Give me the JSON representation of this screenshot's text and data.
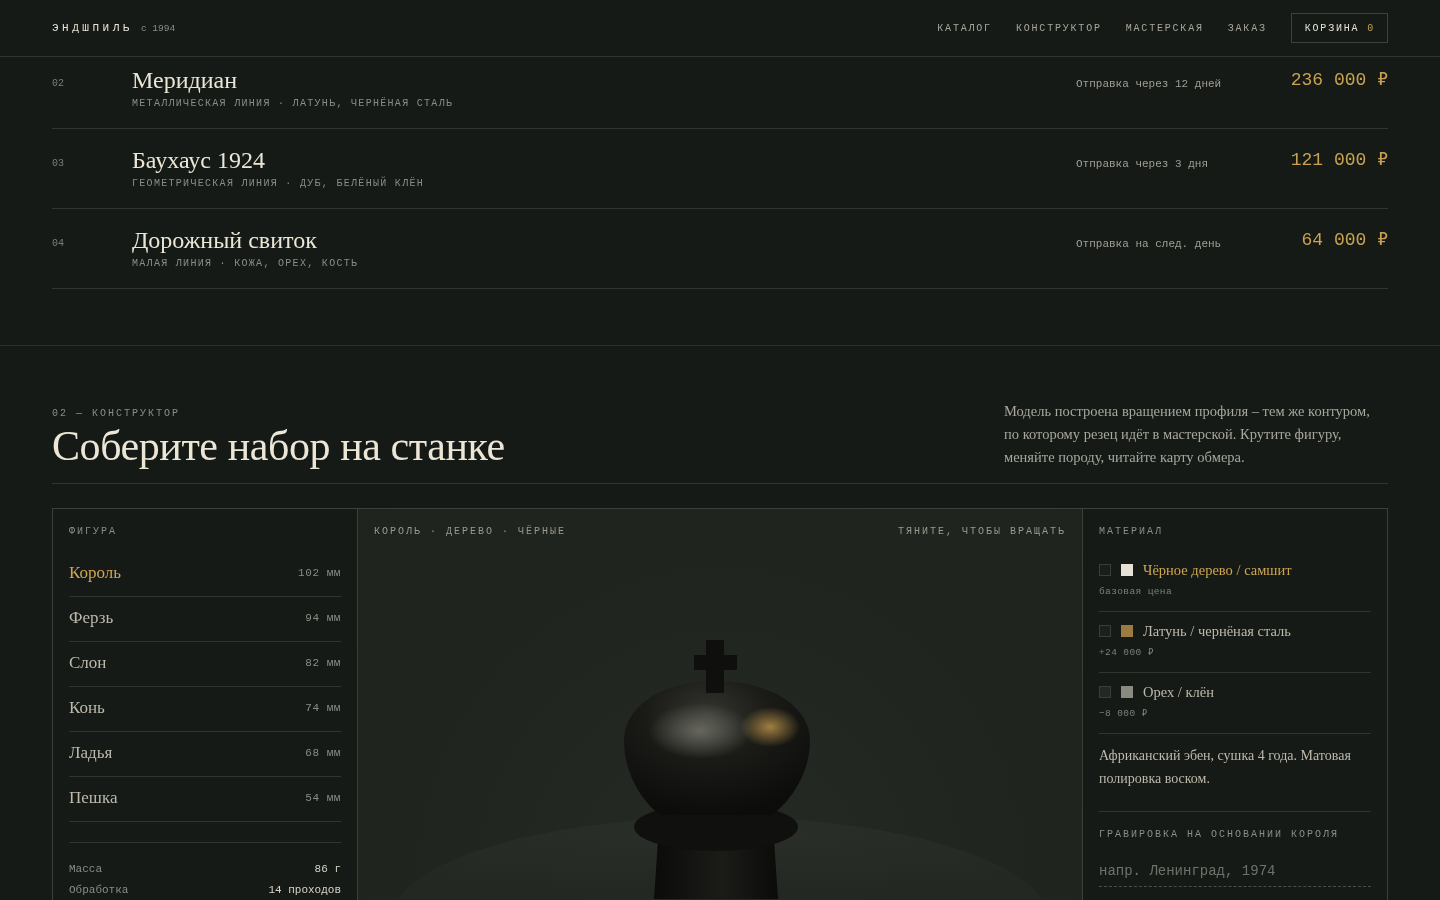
{
  "header": {
    "logo": "ЭНДШПИЛЬ",
    "since": "с 1994",
    "nav": [
      {
        "label": "КАТАЛОГ"
      },
      {
        "label": "КОНСТРУКТОР"
      },
      {
        "label": "МАСТЕРСКАЯ"
      },
      {
        "label": "ЗАКАЗ"
      }
    ],
    "cart": {
      "label": "КОРЗИНА",
      "count": "0"
    }
  },
  "catalog": {
    "rows": [
      {
        "number": "02",
        "title": "Меридиан",
        "subtitle": "МЕТАЛЛИЧЕСКАЯ ЛИНИЯ · ЛАТУНЬ, ЧЕРНЁНАЯ СТАЛЬ",
        "shipping": "Отправка через 12 дней",
        "price": "236 000 ₽"
      },
      {
        "number": "03",
        "title": "Баухаус 1924",
        "subtitle": "ГЕОМЕТРИЧЕСКАЯ ЛИНИЯ · ДУБ, БЕЛЁНЫЙ КЛЁН",
        "shipping": "Отправка через 3 дня",
        "price": "121 000 ₽"
      },
      {
        "number": "04",
        "title": "Дорожный свиток",
        "subtitle": "МАЛАЯ ЛИНИЯ · КОЖА, ОРЕХ, КОСТЬ",
        "shipping": "Отправка на след. день",
        "price": "64 000 ₽"
      }
    ]
  },
  "constructor": {
    "eyebrow": "02 — КОНСТРУКТОР",
    "title": "Соберите набор на станке",
    "intro": "Модель построена вращением профиля – тем же контуром, по которому резец идёт в мастерской. Крутите фигуру, меняйте породу, читайте карту обмера.",
    "figures": {
      "label": "ФИГУРА",
      "items": [
        {
          "name": "Король",
          "size": "102 мм",
          "selected": true
        },
        {
          "name": "Ферзь",
          "size": "94 мм",
          "selected": false
        },
        {
          "name": "Слон",
          "size": "82 мм",
          "selected": false
        },
        {
          "name": "Конь",
          "size": "74 мм",
          "selected": false
        },
        {
          "name": "Ладья",
          "size": "68 мм",
          "selected": false
        },
        {
          "name": "Пешка",
          "size": "54 мм",
          "selected": false
        }
      ]
    },
    "specs": [
      {
        "label": "Масса",
        "value": "86 г"
      },
      {
        "label": "Обработка",
        "value": "14 проходов"
      }
    ],
    "viewer": {
      "caption": "КОРОЛЬ · ДЕРЕВО · ЧЁРНЫЕ",
      "hint": "ТЯНИТЕ, ЧТОБЫ ВРАЩАТЬ"
    },
    "materials": {
      "label": "МАТЕРИАЛ",
      "items": [
        {
          "name": "Чёрное дерево / самшит",
          "note": "базовая цена",
          "selected": true,
          "swatches": [
            {
              "color": "#1b1d1a"
            },
            {
              "color": "#e5e1d5"
            }
          ]
        },
        {
          "name": "Латунь / чернёная сталь",
          "note": "+24 000 ₽",
          "selected": false,
          "swatches": [
            {
              "color": "#1d1f1c"
            },
            {
              "color": "#9b7b40"
            }
          ]
        },
        {
          "name": "Орех / клён",
          "note": "−8 000 ₽",
          "selected": false,
          "swatches": [
            {
              "color": "#242723"
            },
            {
              "color": "#8a8b80"
            }
          ]
        }
      ],
      "description": "Африканский эбен, сушка 4 года. Матовая полировка воском."
    },
    "engraving": {
      "label": "ГРАВИРОВКА НА ОСНОВАНИИ КОРОЛЯ",
      "placeholder": "напр. Ленинград, 1974"
    }
  }
}
